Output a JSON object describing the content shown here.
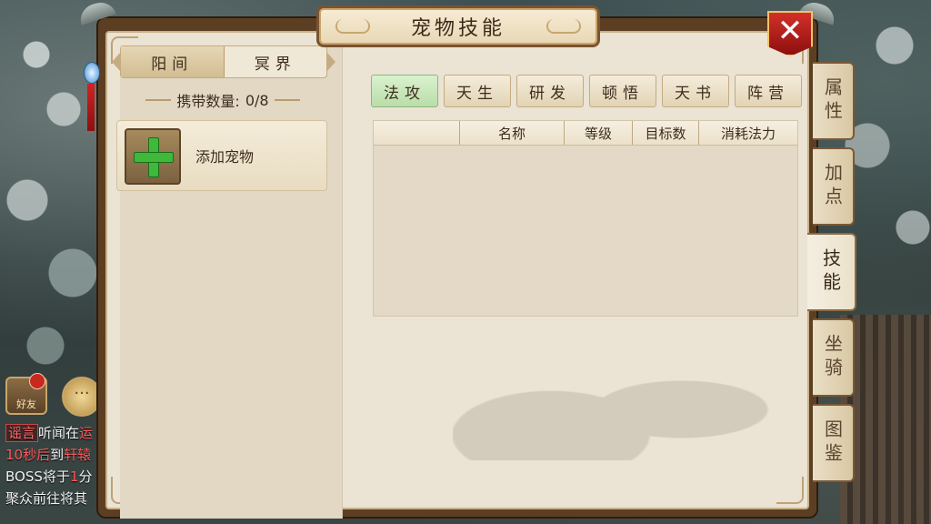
{
  "title": "宠物技能",
  "close_label": "✕",
  "world_tabs": [
    {
      "label": "阳间",
      "active": true
    },
    {
      "label": "冥界",
      "active": false
    }
  ],
  "carry": {
    "label": "携带数量:",
    "value": "0/8"
  },
  "add_pet_label": "添加宠物",
  "skill_tabs": [
    {
      "label": "法攻",
      "active": true
    },
    {
      "label": "天生",
      "active": false
    },
    {
      "label": "研发",
      "active": false
    },
    {
      "label": "顿悟",
      "active": false
    },
    {
      "label": "天书",
      "active": false
    },
    {
      "label": "阵营",
      "active": false
    }
  ],
  "table": {
    "columns": [
      "",
      "名称",
      "等级",
      "目标数",
      "消耗法力"
    ],
    "rows": []
  },
  "side_tabs": [
    {
      "label": "属性",
      "active": false
    },
    {
      "label": "加点",
      "active": false
    },
    {
      "label": "技能",
      "active": true
    },
    {
      "label": "坐骑",
      "active": false
    },
    {
      "label": "图鉴",
      "active": false
    }
  ],
  "chat": {
    "friend_label": "好友",
    "lines": [
      {
        "tag": "谣言",
        "text": "听闻在",
        "tail": "运"
      },
      {
        "red": "10秒后",
        "text": "到",
        "tail": "轩辕"
      },
      {
        "text": "BOSS将于",
        "red": "1",
        "tail": "分"
      },
      {
        "text": "聚众前往将其"
      }
    ]
  },
  "colors": {
    "active_tab": "#b9dda9",
    "close_red": "#c8281e",
    "panel_bg": "#ebe3d3"
  }
}
